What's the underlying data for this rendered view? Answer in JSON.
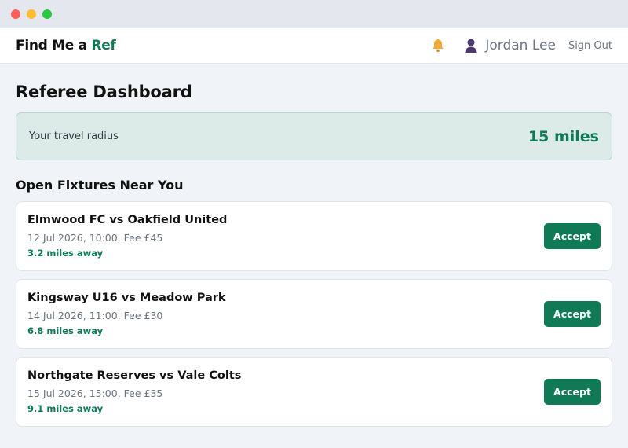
{
  "brand": {
    "name": "Find Me a",
    "accent": "Ref"
  },
  "header": {
    "user_name": "Jordan Lee",
    "sign_out_label": "Sign Out"
  },
  "page": {
    "title": "Referee Dashboard"
  },
  "radius": {
    "label": "Your travel radius",
    "value": "15 miles"
  },
  "fixtures_section": {
    "title": "Open Fixtures Near You"
  },
  "fixtures": [
    {
      "title": "Elmwood FC vs Oakfield United",
      "meta": "12 Jul 2026, 10:00, Fee £45",
      "distance": "3.2 miles away",
      "action": "Accept"
    },
    {
      "title": "Kingsway U16 vs Meadow Park",
      "meta": "14 Jul 2026, 11:00, Fee £30",
      "distance": "6.8 miles away",
      "action": "Accept"
    },
    {
      "title": "Northgate Reserves vs Vale Colts",
      "meta": "15 Jul 2026, 15:00, Fee £35",
      "distance": "9.1 miles away",
      "action": "Accept"
    }
  ],
  "colors": {
    "accent": "#0f7a55",
    "radius_bg": "#dcebe8",
    "bell": "#f2a93b",
    "avatar": "#4a3a6e"
  },
  "icons": {
    "notifications": "bell-icon",
    "user": "user-icon"
  }
}
